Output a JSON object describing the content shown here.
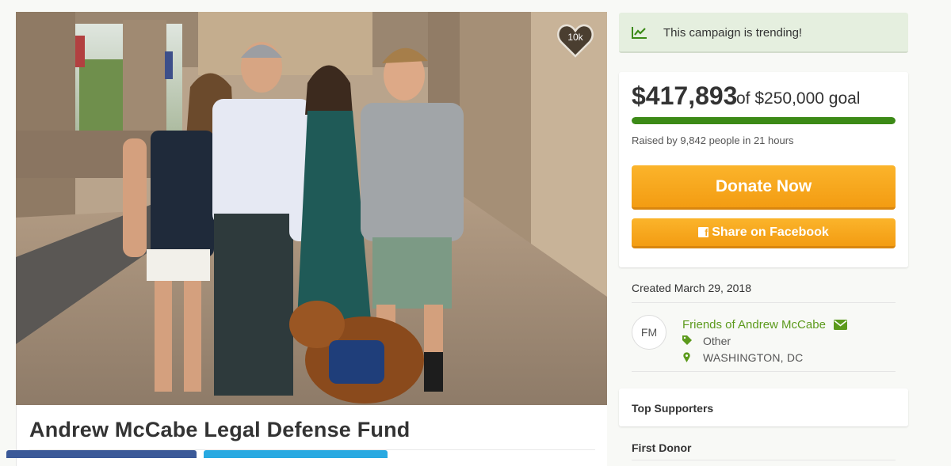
{
  "campaign": {
    "title": "Andrew McCabe Legal Defense Fund",
    "hearts": "10k"
  },
  "trending": {
    "text": "This campaign is trending!",
    "icon": "trending-chart-icon"
  },
  "goal": {
    "amount": "$417,893",
    "of_goal": "of $250,000 goal",
    "progress_fraction": 1.0,
    "raised_text": "Raised by 9,842 people in 21 hours",
    "donate_label": "Donate Now",
    "share_label": "Share on Facebook"
  },
  "organizer": {
    "created": "Created March 29, 2018",
    "initials": "FM",
    "name": "Friends of Andrew McCabe",
    "category": "Other",
    "location": "WASHINGTON, DC"
  },
  "sections": {
    "top_supporters": "Top Supporters",
    "first_donor": "First Donor"
  },
  "colors": {
    "accent_orange": "#f5a31c",
    "progress_green": "#3c8a17",
    "link_green": "#5c9a1c",
    "trend_bg": "#e5efdf",
    "facebook_blue": "#3b5998",
    "twitter_blue": "#29a9e1"
  }
}
